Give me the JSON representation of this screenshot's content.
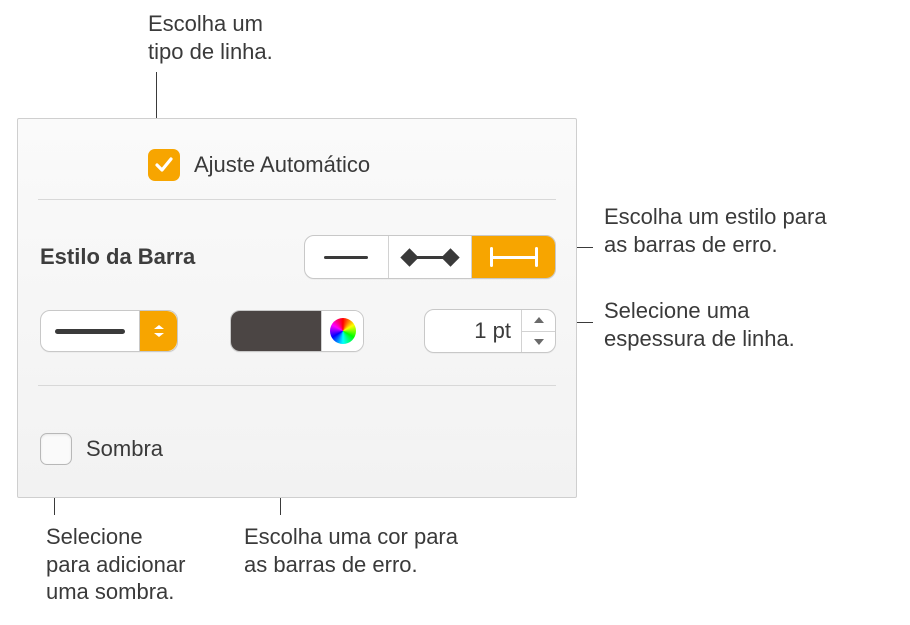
{
  "callouts": {
    "line_type": "Escolha um\ntipo de linha.",
    "bar_style": "Escolha um estilo para\nas barras de erro.",
    "thickness": "Selecione uma\nespessura de linha.",
    "color": "Escolha uma cor para\nas barras de erro.",
    "shadow": "Selecione\npara adicionar\numa sombra."
  },
  "panel": {
    "auto_fit": {
      "label": "Ajuste Automático",
      "checked": true
    },
    "bar_style_label": "Estilo da Barra",
    "segments": {
      "options": [
        "plain",
        "diamond",
        "cap"
      ],
      "selected_index": 2
    },
    "line_type": {
      "selected": "solid"
    },
    "color_hex": "#4b4544",
    "thickness_value": "1 pt",
    "shadow": {
      "label": "Sombra",
      "checked": false
    }
  }
}
